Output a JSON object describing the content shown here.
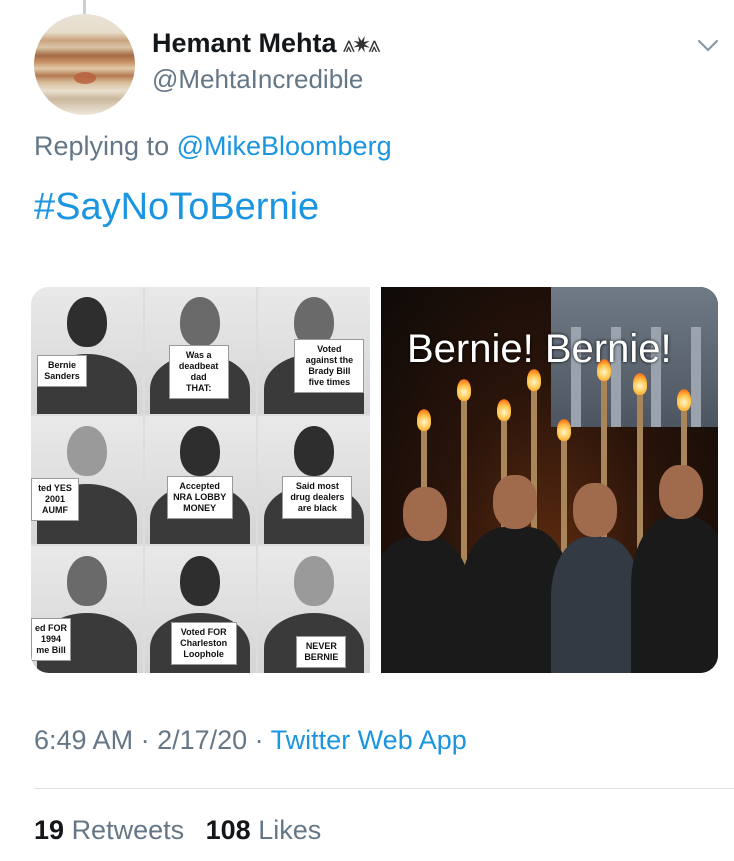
{
  "author": {
    "name": "Hemant Mehta",
    "name_suffix": "⩓✷⩓",
    "handle": "@MehtaIncredible",
    "avatar_icon": "jupiter-avatar"
  },
  "reply": {
    "prefix": "Replying to ",
    "mention": "@MikeBloomberg"
  },
  "tweet": {
    "hashtag": "#SayNoToBernie"
  },
  "media": {
    "grid_signs": [
      "Bernie\nSanders",
      "Was a\ndeadbeat\ndad\nTHAT:",
      "Voted\nagainst the\nBrady Bill\nfive times",
      "ted YES\n2001\nAUMF",
      "Accepted\nNRA LOBBY\nMONEY",
      "Said most\ndrug dealers\nare black",
      "ed FOR\n1994\nme Bill",
      "Voted FOR\nCharleston\nLoophole",
      "NEVER\nBERNIE"
    ],
    "photo_caption": "Bernie! Bernie!"
  },
  "meta": {
    "time": "6:49 AM",
    "separator": " · ",
    "date": "2/17/20",
    "app": "Twitter Web App"
  },
  "stats": {
    "retweets_count": "19",
    "retweets_label": "Retweets",
    "likes_count": "108",
    "likes_label": "Likes"
  },
  "colors": {
    "link": "#1b95e0",
    "secondary_text": "#657786",
    "primary_text": "#14171a"
  }
}
